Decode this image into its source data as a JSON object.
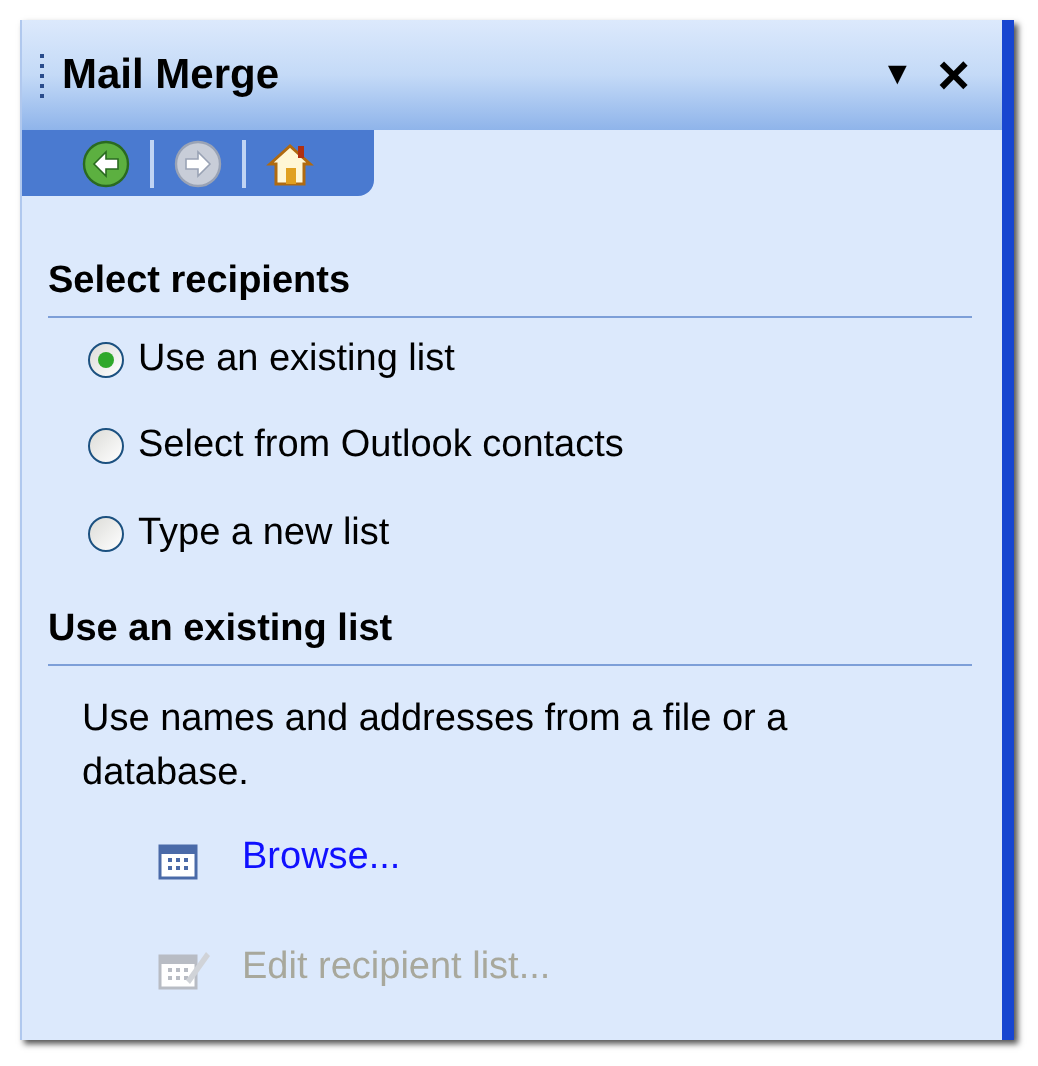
{
  "pane": {
    "title": "Mail Merge",
    "menu_arrow": "▼",
    "close": "×"
  },
  "nav_buttons": [
    {
      "kind": "back",
      "disabled": false
    },
    {
      "kind": "forward",
      "disabled": true
    },
    {
      "kind": "home",
      "disabled": false
    }
  ],
  "sections": [
    {
      "heading": "Select recipients",
      "options": [
        {
          "label": "Use an existing list",
          "selected": true
        },
        {
          "label": "Select from Outlook contacts",
          "selected": false
        },
        {
          "label": "Type a new list",
          "selected": false
        }
      ]
    },
    {
      "heading": "Use an existing list",
      "description": "Use names and addresses from a file or a database.",
      "links": [
        {
          "label": "Browse...",
          "kind": "browse",
          "disabled": false
        },
        {
          "label": "Edit recipient list...",
          "kind": "edit",
          "disabled": true
        }
      ]
    }
  ]
}
